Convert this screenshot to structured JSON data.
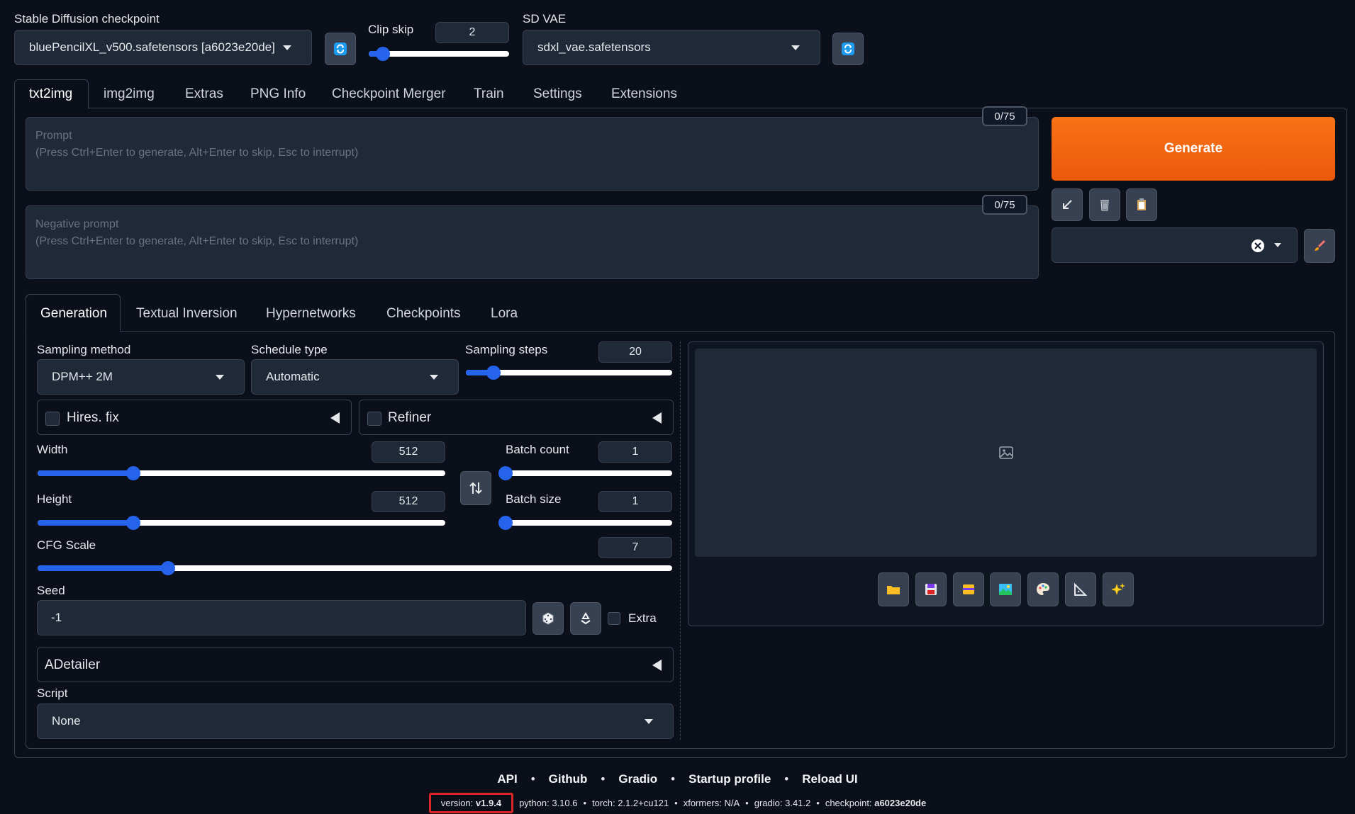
{
  "top": {
    "checkpoint_label": "Stable Diffusion checkpoint",
    "checkpoint_value": "bluePencilXL_v500.safetensors [a6023e20de]",
    "clip_skip_label": "Clip skip",
    "clip_skip_value": "2",
    "clip_skip_fraction": 0.1,
    "vae_label": "SD VAE",
    "vae_value": "sdxl_vae.safetensors"
  },
  "main_tabs": [
    "txt2img",
    "img2img",
    "Extras",
    "PNG Info",
    "Checkpoint Merger",
    "Train",
    "Settings",
    "Extensions"
  ],
  "prompt": {
    "label": "Prompt",
    "hint": "(Press Ctrl+Enter to generate, Alt+Enter to skip, Esc to interrupt)",
    "token_count": "0/75"
  },
  "negative_prompt": {
    "label": "Negative prompt",
    "hint": "(Press Ctrl+Enter to generate, Alt+Enter to skip, Esc to interrupt)",
    "token_count": "0/75"
  },
  "generate_label": "Generate",
  "sub_tabs": [
    "Generation",
    "Textual Inversion",
    "Hypernetworks",
    "Checkpoints",
    "Lora"
  ],
  "generation": {
    "sampling_method_label": "Sampling method",
    "sampling_method_value": "DPM++ 2M",
    "schedule_type_label": "Schedule type",
    "schedule_type_value": "Automatic",
    "sampling_steps_label": "Sampling steps",
    "sampling_steps_value": "20",
    "hires_label": "Hires. fix",
    "refiner_label": "Refiner",
    "width_label": "Width",
    "width_value": "512",
    "height_label": "Height",
    "height_value": "512",
    "batch_count_label": "Batch count",
    "batch_count_value": "1",
    "batch_size_label": "Batch size",
    "batch_size_value": "1",
    "cfg_label": "CFG Scale",
    "cfg_value": "7",
    "seed_label": "Seed",
    "seed_value": "-1",
    "extra_label": "Extra",
    "adetailer_label": "ADetailer",
    "script_label": "Script",
    "script_value": "None"
  },
  "icons": {
    "refresh": "refresh-icon",
    "arrow": "arrow-down-left-icon",
    "trash": "trash-icon",
    "clipboard": "clipboard-icon",
    "brush": "paint-brush-icon",
    "swap": "swap-icon",
    "dice": "dice-icon",
    "recycle": "recycle-icon",
    "image": "image-placeholder-icon",
    "output_tools": [
      "folder-icon",
      "save-icon",
      "zip-icon",
      "image-icon",
      "palette-icon",
      "ruler-icon",
      "sparkles-icon"
    ]
  },
  "footer": {
    "links": [
      "API",
      "Github",
      "Gradio",
      "Startup profile",
      "Reload UI"
    ],
    "version_label": "version:",
    "version_value": "v1.9.4",
    "python_label": "python:",
    "python": "3.10.6",
    "torch_label": "torch:",
    "torch": "2.1.2+cu121",
    "xformers_label": "xformers:",
    "xformers": "N/A",
    "gradio_label": "gradio:",
    "gradio": "3.41.2",
    "checkpoint_label": "checkpoint:",
    "checkpoint": "a6023e20de"
  },
  "colors": {
    "background": "#0b0f19",
    "accent": "#2563eb",
    "generate_start": "#f97316",
    "generate_end": "#ea580c",
    "highlight_border": "#dc2626"
  }
}
